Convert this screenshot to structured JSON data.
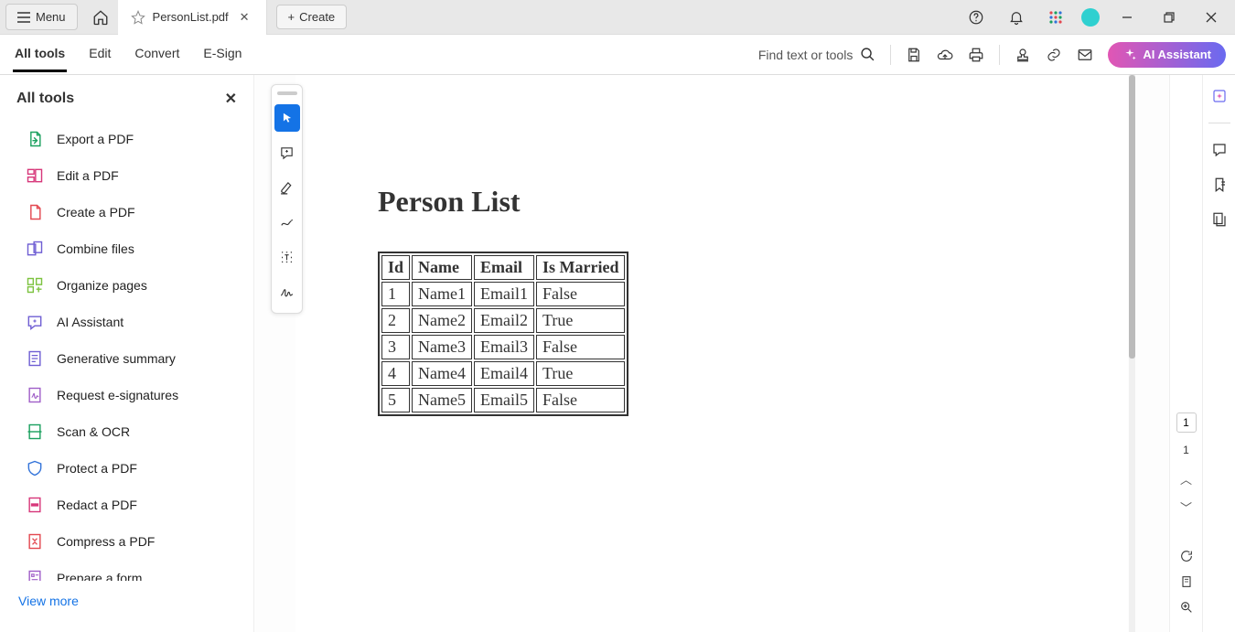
{
  "titlebar": {
    "menu_label": "Menu",
    "tab_filename": "PersonList.pdf",
    "create_label": "Create"
  },
  "toolbar": {
    "tabs": [
      "All tools",
      "Edit",
      "Convert",
      "E-Sign"
    ],
    "search_placeholder": "Find text or tools",
    "ai_label": "AI Assistant"
  },
  "sidebar": {
    "title": "All tools",
    "items": [
      {
        "label": "Export a PDF",
        "icon": "export",
        "color": "#1ba05f"
      },
      {
        "label": "Edit a PDF",
        "icon": "edit",
        "color": "#d7377a"
      },
      {
        "label": "Create a PDF",
        "icon": "create",
        "color": "#e34850"
      },
      {
        "label": "Combine files",
        "icon": "combine",
        "color": "#6f5ed3"
      },
      {
        "label": "Organize pages",
        "icon": "organize",
        "color": "#7cc33f"
      },
      {
        "label": "AI Assistant",
        "icon": "ai",
        "color": "#6f5ed3"
      },
      {
        "label": "Generative summary",
        "icon": "summary",
        "color": "#6f5ed3"
      },
      {
        "label": "Request e-signatures",
        "icon": "esign",
        "color": "#a05fc8"
      },
      {
        "label": "Scan & OCR",
        "icon": "scan",
        "color": "#1ba05f"
      },
      {
        "label": "Protect a PDF",
        "icon": "protect",
        "color": "#3273d9"
      },
      {
        "label": "Redact a PDF",
        "icon": "redact",
        "color": "#d7377a"
      },
      {
        "label": "Compress a PDF",
        "icon": "compress",
        "color": "#e34850"
      },
      {
        "label": "Prepare a form",
        "icon": "form",
        "color": "#a05fc8"
      }
    ],
    "view_more": "View more"
  },
  "document": {
    "heading": "Person List",
    "columns": [
      "Id",
      "Name",
      "Email",
      "Is Married"
    ],
    "rows": [
      [
        "1",
        "Name1",
        "Email1",
        "False"
      ],
      [
        "2",
        "Name2",
        "Email2",
        "True"
      ],
      [
        "3",
        "Name3",
        "Email3",
        "False"
      ],
      [
        "4",
        "Name4",
        "Email4",
        "True"
      ],
      [
        "5",
        "Name5",
        "Email5",
        "False"
      ]
    ]
  },
  "page_nav": {
    "current": "1",
    "total": "1"
  }
}
